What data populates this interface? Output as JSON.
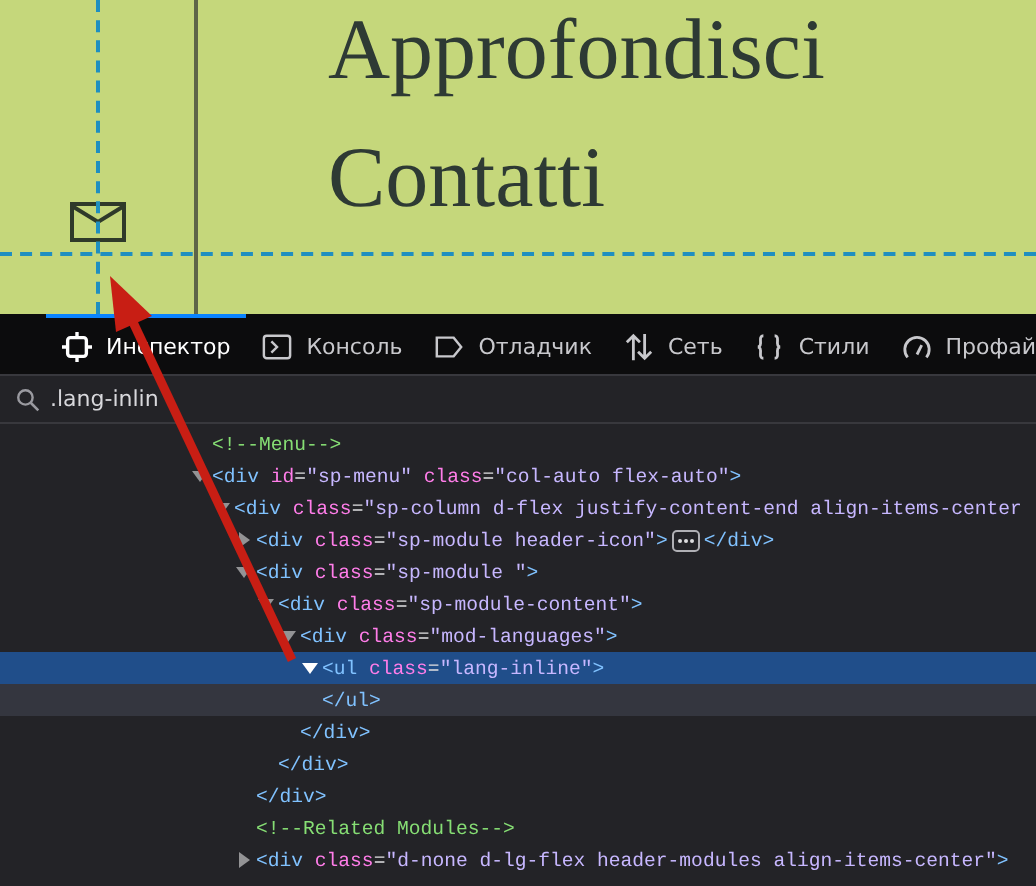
{
  "page": {
    "headings": [
      "Approfondisci",
      "Contatti"
    ]
  },
  "toolbar": {
    "tabs": [
      {
        "kind": "inspector",
        "label": "Инспектор",
        "selected": true
      },
      {
        "kind": "console",
        "label": "Консоль",
        "selected": false
      },
      {
        "kind": "debugger",
        "label": "Отладчик",
        "selected": false
      },
      {
        "kind": "network",
        "label": "Сеть",
        "selected": false
      },
      {
        "kind": "styles",
        "label": "Стили",
        "selected": false
      },
      {
        "kind": "profiler",
        "label": "Профай",
        "selected": false
      }
    ]
  },
  "search": {
    "value": ".lang-inlin"
  },
  "tree": [
    {
      "kind": "comment",
      "text": "<!--Menu-->"
    },
    {
      "kind": "element",
      "expanded": true,
      "selected": false,
      "tokens": [
        {
          "kind": "tag",
          "text": "<div"
        },
        {
          "kind": "attr",
          "text": " id"
        },
        {
          "kind": "eq",
          "text": "="
        },
        {
          "kind": "value",
          "text": "\"sp-menu\""
        },
        {
          "kind": "attr",
          "text": " class"
        },
        {
          "kind": "eq",
          "text": "="
        },
        {
          "kind": "value",
          "text": "\"col-auto flex-auto\""
        },
        {
          "kind": "tag",
          "text": ">"
        }
      ],
      "children": [
        {
          "kind": "element",
          "expanded": true,
          "selected": false,
          "tokens": [
            {
              "kind": "tag",
              "text": "<div"
            },
            {
              "kind": "attr",
              "text": " class"
            },
            {
              "kind": "eq",
              "text": "="
            },
            {
              "kind": "value",
              "text": "\"sp-column d-flex justify-content-end align-items-center"
            }
          ],
          "children": [
            {
              "kind": "element",
              "expanded": false,
              "selected": false,
              "ellipsis": true,
              "tokens": [
                {
                  "kind": "tag",
                  "text": "<div"
                },
                {
                  "kind": "attr",
                  "text": " class"
                },
                {
                  "kind": "eq",
                  "text": "="
                },
                {
                  "kind": "value",
                  "text": "\"sp-module header-icon\""
                },
                {
                  "kind": "tag",
                  "text": ">"
                }
              ],
              "close": "</div>"
            },
            {
              "kind": "element",
              "expanded": true,
              "selected": false,
              "tokens": [
                {
                  "kind": "tag",
                  "text": "<div"
                },
                {
                  "kind": "attr",
                  "text": " class"
                },
                {
                  "kind": "eq",
                  "text": "="
                },
                {
                  "kind": "value",
                  "text": "\"sp-module \""
                },
                {
                  "kind": "tag",
                  "text": ">"
                }
              ],
              "close": "</div>",
              "children": [
                {
                  "kind": "element",
                  "expanded": true,
                  "selected": false,
                  "tokens": [
                    {
                      "kind": "tag",
                      "text": "<div"
                    },
                    {
                      "kind": "attr",
                      "text": " class"
                    },
                    {
                      "kind": "eq",
                      "text": "="
                    },
                    {
                      "kind": "value",
                      "text": "\"sp-module-content\""
                    },
                    {
                      "kind": "tag",
                      "text": ">"
                    }
                  ],
                  "close": "</div>",
                  "children": [
                    {
                      "kind": "element",
                      "expanded": true,
                      "selected": false,
                      "tokens": [
                        {
                          "kind": "tag",
                          "text": "<div"
                        },
                        {
                          "kind": "attr",
                          "text": " class"
                        },
                        {
                          "kind": "eq",
                          "text": "="
                        },
                        {
                          "kind": "value",
                          "text": "\"mod-languages\""
                        },
                        {
                          "kind": "tag",
                          "text": ">"
                        }
                      ],
                      "close": "</div>",
                      "children": [
                        {
                          "kind": "element",
                          "expanded": true,
                          "selected": true,
                          "tokens": [
                            {
                              "kind": "tag",
                              "text": "<ul"
                            },
                            {
                              "kind": "attr",
                              "text": " class"
                            },
                            {
                              "kind": "eq",
                              "text": "="
                            },
                            {
                              "kind": "value",
                              "text": "\"lang-inline\""
                            },
                            {
                              "kind": "tag",
                              "text": ">"
                            }
                          ],
                          "close": "</ul>"
                        }
                      ]
                    }
                  ]
                }
              ]
            },
            {
              "kind": "comment",
              "text": "<!--Related Modules-->"
            },
            {
              "kind": "element",
              "expanded": false,
              "selected": false,
              "ellipsis": false,
              "tokens": [
                {
                  "kind": "tag",
                  "text": "<div"
                },
                {
                  "kind": "attr",
                  "text": " class"
                },
                {
                  "kind": "eq",
                  "text": "="
                },
                {
                  "kind": "value",
                  "text": "\"d-none d-lg-flex header-modules align-items-center\""
                },
                {
                  "kind": "tag",
                  "text": ">"
                }
              ]
            }
          ]
        }
      ]
    }
  ]
}
